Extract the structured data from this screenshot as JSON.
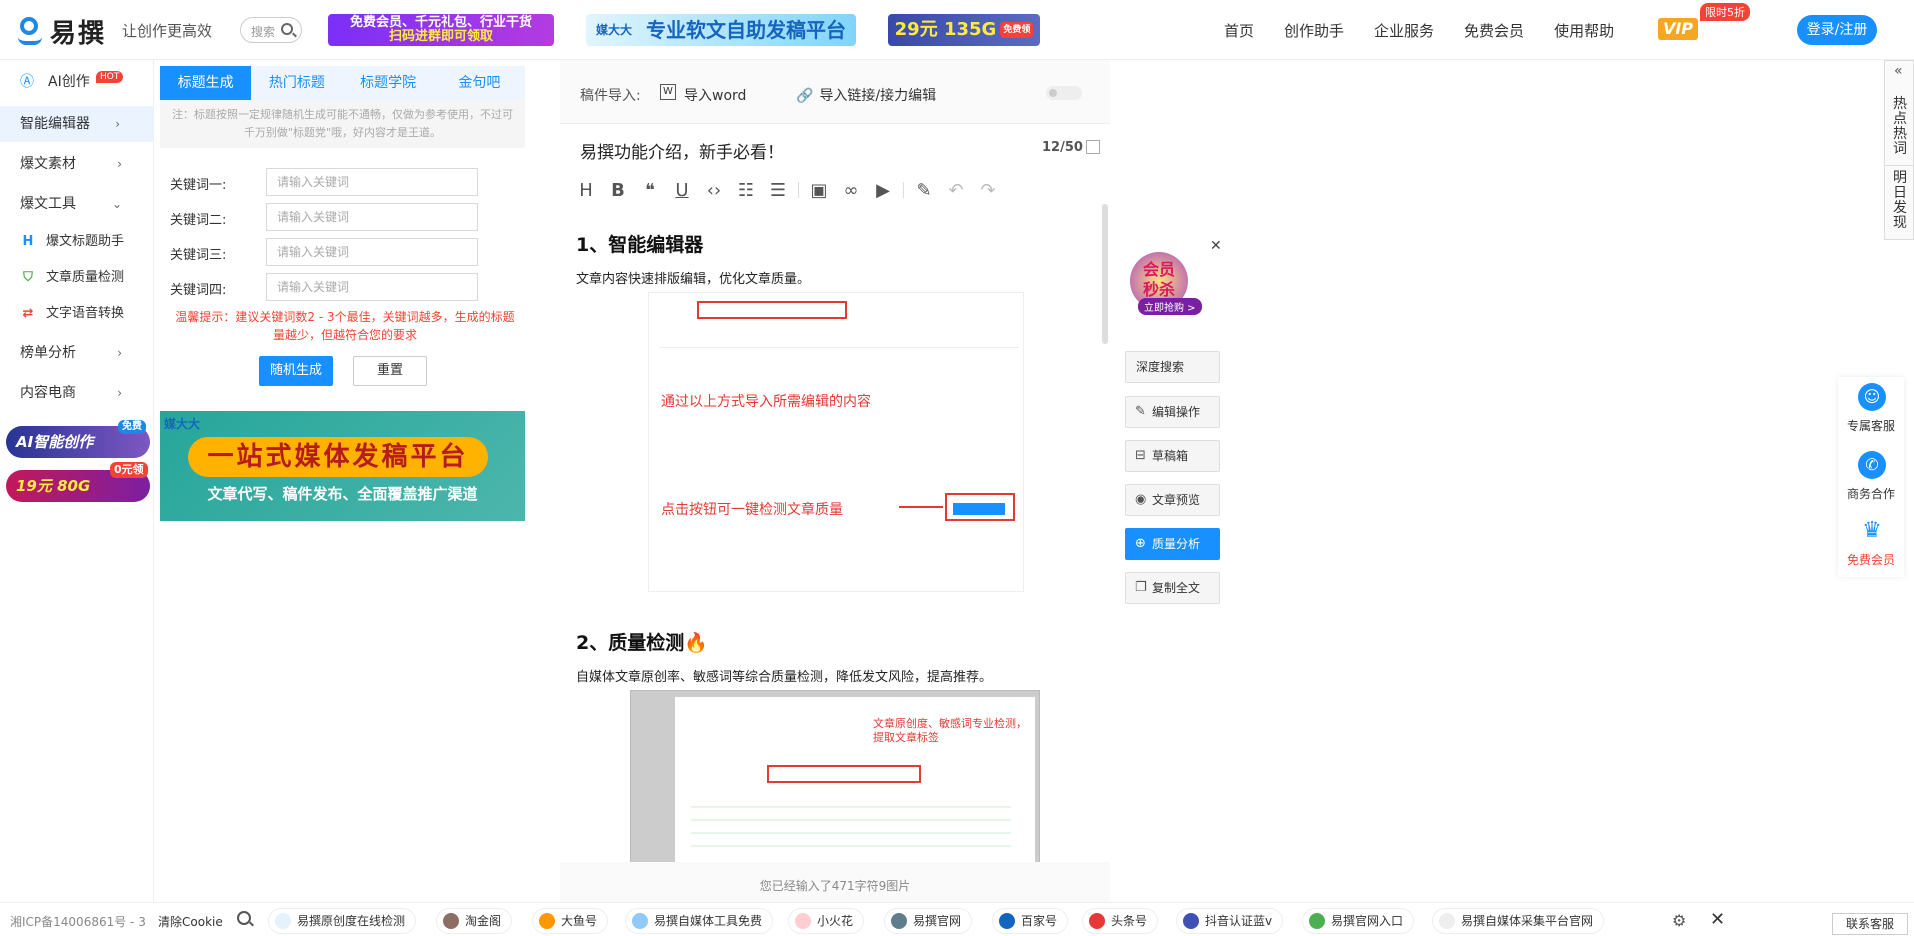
{
  "header": {
    "brand": "易撰",
    "slogan": "让创作更高效",
    "search_label": "搜索",
    "banner1_l1": "免费会员、千元礼包、行业干货",
    "banner1_l2": "扫码进群即可领取",
    "banner2": "专业软文自助发稿平台",
    "banner2_logo": "媒大大",
    "banner3": "29元 135G",
    "banner3_tag": "免费领",
    "nav": [
      "首页",
      "创作助手",
      "企业服务",
      "免费会员",
      "使用帮助"
    ],
    "vip": "VIP",
    "vip_badge": "限时5折",
    "login": "登录/注册"
  },
  "sidebar": {
    "ai": "AI创作",
    "hot": "HOT",
    "items": [
      "智能编辑器",
      "爆文素材",
      "爆文工具",
      "榜单分析",
      "内容电商"
    ],
    "subitems": [
      "爆文标题助手",
      "文章质量检测",
      "文字语音转换"
    ],
    "promo1": "AI智能创作",
    "promo1_tag": "免费",
    "promo2": "19元 80G",
    "promo2_tag": "0元领"
  },
  "tool": {
    "tabs": [
      "标题生成",
      "热门标题",
      "标题学院",
      "金句吧"
    ],
    "tip": "注：标题按照一定规律随机生成可能不通畅，仅做为参考使用，不过可千万别做\"标题党\"哦，好内容才是王道。",
    "kw_labels": [
      "关键词一:",
      "关键词二:",
      "关键词三:",
      "关键词四:"
    ],
    "kw_placeholder": "请输入关键词",
    "warm_tip": "温馨提示：建议关键词数2 - 3个最佳，关键词越多，生成的标题量越少，但越符合您的要求",
    "gen": "随机生成",
    "reset": "重置",
    "ad_logo": "媒大大",
    "ad_title": "一站式媒体发稿平台",
    "ad_sub": "文章代写、稿件发布、全面覆盖推广渠道"
  },
  "editor": {
    "import_label": "稿件导入:",
    "import_word": "导入word",
    "import_link": "导入链接/接力编辑",
    "title": "易撰功能介绍，新手必看！",
    "title_count": "12/50",
    "h1": "1、智能编辑器",
    "p1": "文章内容快速排版编辑，优化文章质量。",
    "shot1_a": "通过以上方式导入所需编辑的内容",
    "shot1_b": "点击按钮可一键检测文章质量",
    "h2": "2、质量检测🔥",
    "p2": "自媒体文章原创率、敏感词等综合质量检测，降低发文风险，提高推荐。",
    "shot2_a": "文章原创度、敏感词专业检测，",
    "shot2_b": "提取文章标签",
    "word_count": "您已经输入了471字符9图片"
  },
  "right": {
    "mem_l1": "会员",
    "mem_l2": "秒杀",
    "mem_go": "立即抢购 >",
    "buttons": [
      "深度搜索",
      "编辑操作",
      "草稿箱",
      "文章预览",
      "质量分析",
      "复制全文"
    ],
    "tab1": "热点热词",
    "tab2": "明日发现",
    "services": [
      "专属客服",
      "商务合作",
      "免费会员"
    ]
  },
  "footer": {
    "icp": "湘ICP备14006861号 - 3",
    "clear": "清除Cookie",
    "chips": [
      "易撰原创度在线检测",
      "淘金阁",
      "大鱼号",
      "易撰自媒体工具免费",
      "小火花",
      "易撰官网",
      "百家号",
      "头条号",
      "抖音认证蓝v",
      "易撰官网入口",
      "易撰自媒体采集平台官网"
    ],
    "contact": "联系客服"
  },
  "colors": {
    "primary": "#1890ff",
    "warning": "#f44336"
  }
}
